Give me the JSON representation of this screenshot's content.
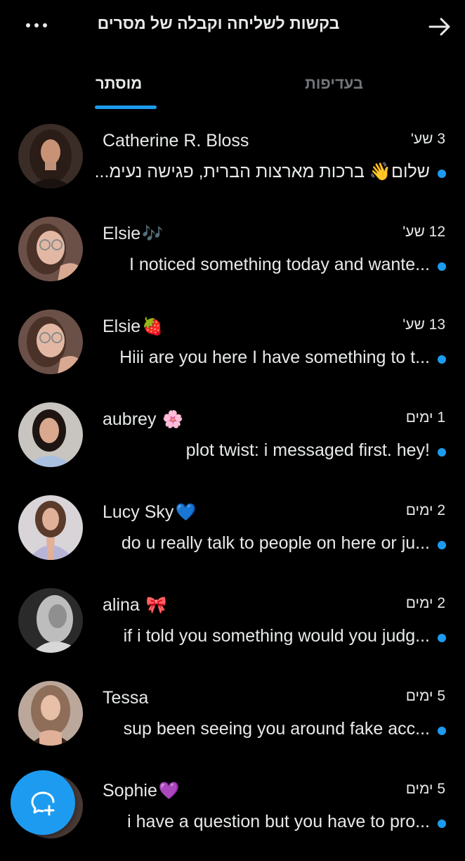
{
  "header": {
    "title": "בקשות לשליחה וקבלה של מסרים"
  },
  "tabs": [
    {
      "label": "מוסתר",
      "active": true
    },
    {
      "label": "בעדיפות",
      "active": false
    }
  ],
  "colors": {
    "accent": "#1d9bf0",
    "background": "#000000",
    "text": "#e7e9ea",
    "muted": "#71767b"
  },
  "messages": [
    {
      "name": "Catherine R. Bloss",
      "emoji": "",
      "time": "3 שע'",
      "preview": "שלום👋 ברכות מארצות הברית, פגישה נעימ...",
      "unread": true
    },
    {
      "name": "Elsie",
      "emoji": "🎶",
      "time": "12 שע'",
      "preview": "I noticed something today and wante...",
      "unread": true
    },
    {
      "name": "Elsie",
      "emoji": "🍓",
      "time": "13 שע'",
      "preview": "Hiii are you here I have something to t...",
      "unread": true
    },
    {
      "name": "aubrey",
      "emoji": " 🌸",
      "time": "1 ימים",
      "preview": "plot twist: i messaged first. hey!",
      "unread": true
    },
    {
      "name": "Lucy Sky",
      "emoji": "💙",
      "time": "2 ימים",
      "preview": "do u really talk to people on here or ju...",
      "unread": true
    },
    {
      "name": "alina",
      "emoji": " 🎀",
      "time": "2 ימים",
      "preview": "if i told you something would you judg...",
      "unread": true
    },
    {
      "name": "Tessa",
      "emoji": "",
      "time": "5 ימים",
      "preview": "sup been seeing you around fake acc...",
      "unread": true
    },
    {
      "name": "Sophie",
      "emoji": "💜",
      "time": "5 ימים",
      "preview": "i have a question but you have to pro...",
      "unread": true
    }
  ],
  "icons": {
    "more": "more-horizontal-icon",
    "back": "arrow-right-icon",
    "compose": "new-message-icon"
  }
}
